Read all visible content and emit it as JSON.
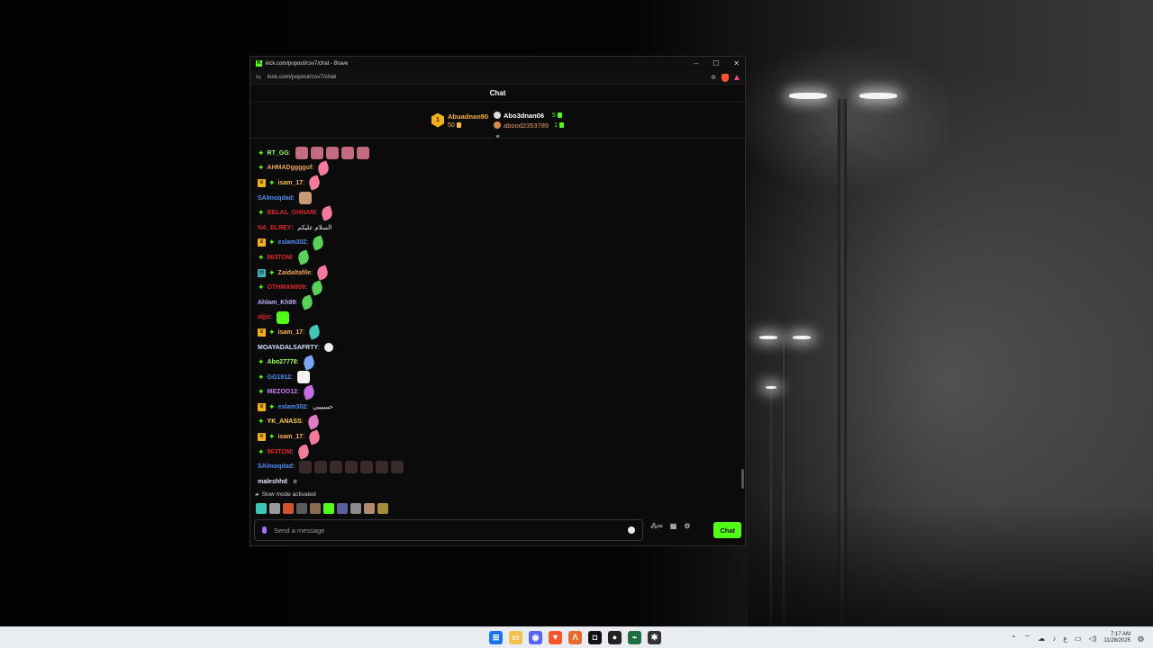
{
  "window": {
    "title": "kick.com/popout/csv7/chat - Brave",
    "url": "kick.com/popout/csv7/chat",
    "min_glyph": "–",
    "max_glyph": "☐",
    "close_glyph": "✕"
  },
  "chat": {
    "header": "Chat",
    "leaderboard": {
      "first": {
        "rank": "1",
        "name": "Abuadnan90",
        "count": "50"
      },
      "second": {
        "name": "Abo3dnan06",
        "count": "5"
      },
      "third": {
        "name": "abood2353789",
        "count": "1"
      }
    },
    "messages": [
      {
        "badges": [
          "star"
        ],
        "user": "RT_GG",
        "color": "#9cff5b",
        "text": "",
        "emotes": [
          "#c46b82",
          "#c46b82",
          "#c46b82",
          "#c46b82",
          "#c46b82"
        ],
        "emote_type": "sq"
      },
      {
        "badges": [
          "star"
        ],
        "user": "AHMADgggguf",
        "color": "#f0a35a",
        "text": "",
        "emotes": [
          "#f27b9b"
        ],
        "emote_type": "feather"
      },
      {
        "badges": [
          "crown",
          "star"
        ],
        "user": "isam_17",
        "color": "#ffb84d",
        "text": "",
        "emotes": [
          "#f27b9b"
        ],
        "emote_type": "feather"
      },
      {
        "badges": [],
        "user": "SAlmoqdad",
        "color": "#4f8ef7",
        "text": "",
        "emotes": [
          "#c99a73"
        ],
        "emote_type": "sq"
      },
      {
        "badges": [
          "star"
        ],
        "user": "BELAL_GHNAM",
        "color": "#e0262b",
        "text": "",
        "emotes": [
          "#f27b9b"
        ],
        "emote_type": "feather"
      },
      {
        "badges": [],
        "user": "NA_ELREY",
        "color": "#e0262b",
        "text": "السلام عليكم",
        "emotes": [],
        "emote_type": ""
      },
      {
        "badges": [
          "crown",
          "star"
        ],
        "user": "eslam302",
        "color": "#4f8ef7",
        "text": "",
        "emotes": [
          "#5ad25a"
        ],
        "emote_type": "feather"
      },
      {
        "badges": [
          "star"
        ],
        "user": "963TOM",
        "color": "#e0262b",
        "text": "",
        "emotes": [
          "#5ad25a"
        ],
        "emote_type": "feather"
      },
      {
        "badges": [
          "sub",
          "star"
        ],
        "user": "Zaidaltafile",
        "color": "#f0a35a",
        "text": "",
        "emotes": [
          "#f27b9b"
        ],
        "emote_type": "feather"
      },
      {
        "badges": [
          "star"
        ],
        "user": "OTHMAN909",
        "color": "#e0262b",
        "text": "",
        "emotes": [
          "#5ad25a"
        ],
        "emote_type": "feather"
      },
      {
        "badges": [],
        "user": "Ahlam_Kh99",
        "color": "#b9b2ff",
        "text": "",
        "emotes": [
          "#5ad25a"
        ],
        "emote_type": "feather"
      },
      {
        "badges": [],
        "user": "aljjo",
        "color": "#e0262b",
        "text": "",
        "emotes": [
          "#53fc18"
        ],
        "emote_type": "sq"
      },
      {
        "badges": [
          "crown",
          "star"
        ],
        "user": "isam_17",
        "color": "#ffb84d",
        "text": "",
        "emotes": [
          "#3fc5b5"
        ],
        "emote_type": "feather"
      },
      {
        "badges": [],
        "user": "MOAYADALSAFRTY",
        "color": "#cfe3ff",
        "text": "",
        "emotes": [
          "#eeeeee"
        ],
        "emote_type": "small"
      },
      {
        "badges": [
          "star"
        ],
        "user": "Abo27778",
        "color": "#9cff5b",
        "text": "",
        "emotes": [
          "#7aa6f0"
        ],
        "emote_type": "feather"
      },
      {
        "badges": [
          "star"
        ],
        "user": "GG1912",
        "color": "#4f8ef7",
        "text": "",
        "emotes": [
          "#f2f2f2"
        ],
        "emote_type": "sq"
      },
      {
        "badges": [
          "star"
        ],
        "user": "MEZOO12",
        "color": "#c77dff",
        "text": "",
        "emotes": [
          "#c36de0"
        ],
        "emote_type": "feather"
      },
      {
        "badges": [
          "crown",
          "star"
        ],
        "user": "eslam302",
        "color": "#4f8ef7",
        "text": "حبيبيييي",
        "emotes": [],
        "emote_type": ""
      },
      {
        "badges": [
          "star"
        ],
        "user": "YK_ANASS",
        "color": "#ffd24d",
        "text": "",
        "emotes": [
          "#e07ac8"
        ],
        "emote_type": "feather"
      },
      {
        "badges": [
          "crown",
          "star"
        ],
        "user": "isam_17",
        "color": "#ffb84d",
        "text": "",
        "emotes": [
          "#f27b9b"
        ],
        "emote_type": "feather"
      },
      {
        "badges": [
          "star"
        ],
        "user": "963TOM",
        "color": "#e0262b",
        "text": "",
        "emotes": [
          "#f27b9b"
        ],
        "emote_type": "feather"
      },
      {
        "badges": [],
        "user": "SAlmoqdad",
        "color": "#4f8ef7",
        "text": "",
        "emotes": [
          "#3a2a2a",
          "#3a2a2a",
          "#3a2a2a",
          "#3a2a2a",
          "#3a2a2a",
          "#3a2a2a",
          "#3a2a2a"
        ],
        "emote_type": "sq"
      },
      {
        "badges": [],
        "user": "maleshhd",
        "color": "#e8e8ff",
        "text": "o",
        "emotes": [],
        "emote_type": ""
      }
    ],
    "slow_mode": "Slow mode activated",
    "quick_emotes": [
      "#3fc5b5",
      "#9a9a9a",
      "#d0532e",
      "#5b5b5b",
      "#8a6a52",
      "#53fc18",
      "#5a5fa0",
      "#8b8b8b",
      "#b08970",
      "#a68b3a"
    ],
    "composer": {
      "placeholder": "Send a message"
    },
    "send_label": "Chat"
  },
  "taskbar": {
    "time": "7:17 AM",
    "date": "11/28/2025"
  }
}
